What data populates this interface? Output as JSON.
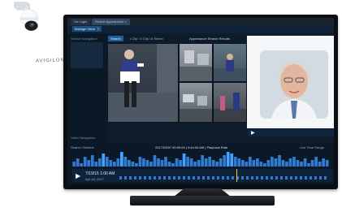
{
  "browser": {
    "tabs": [
      "Vic Login",
      "Search Appearance ×"
    ]
  },
  "app": {
    "buttons": [
      "Manage Views",
      "≡"
    ],
    "search_button": "Search",
    "clip_info": "1 Clip / 4 Clip / 6 Select",
    "title": "Appearance Search Results",
    "left_panel_label": "Search Navigation",
    "left_panel_sub": "Video Navigation"
  },
  "camera_brand": "AVIGILON",
  "timeline": {
    "left_label": "Search Timeline",
    "center_label": "2017/03/07 00:00:00  |  9:44:00 AM  |  Playback Rate",
    "time_readout": "7/19/15 1:00 AM",
    "date_readout": "Apr 18, 2017",
    "right_label": "Live Time Range"
  },
  "colors": {
    "bg": "#ffffff",
    "screen": "#0d1b2a",
    "accent": "#2d7fd0",
    "bars": "#2e7bd1",
    "highlight_bar": "#3fa3ff"
  },
  "chart_data": {
    "type": "bar",
    "title": "",
    "xlabel": "",
    "ylabel": "",
    "values": [
      3,
      5,
      2,
      6,
      4,
      7,
      3,
      5,
      8,
      6,
      4,
      3,
      5,
      9,
      6,
      4,
      3,
      2,
      6,
      5,
      4,
      3,
      7,
      5,
      4,
      6,
      3,
      2,
      5,
      4,
      8,
      6,
      5,
      3,
      4,
      7,
      5,
      6,
      4,
      3,
      5,
      7,
      9,
      8,
      6,
      5,
      4,
      3,
      6,
      4,
      5,
      3,
      2,
      4,
      6,
      5,
      7,
      4,
      3,
      5,
      6,
      4,
      3,
      5,
      2,
      4,
      6,
      3,
      5,
      4
    ],
    "ylim": [
      0,
      10
    ]
  }
}
